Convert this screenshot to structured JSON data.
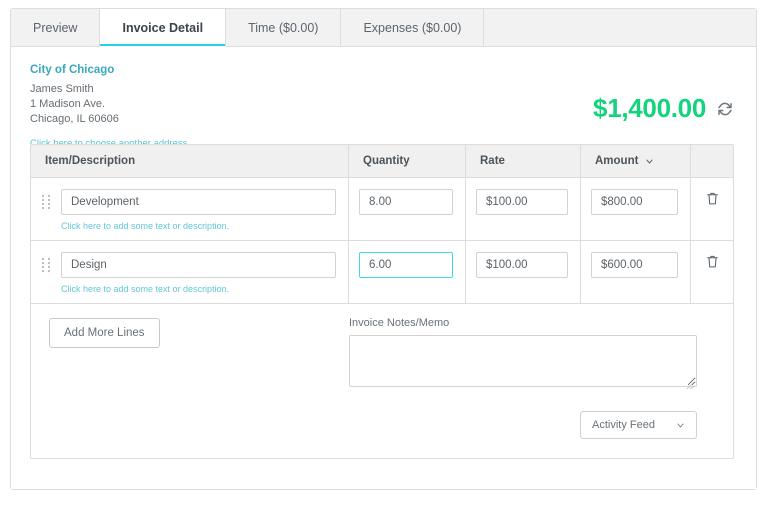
{
  "tabs": [
    {
      "label": "Preview",
      "active": false
    },
    {
      "label": "Invoice Detail",
      "active": true
    },
    {
      "label": "Time ($0.00)",
      "active": false
    },
    {
      "label": "Expenses ($0.00)",
      "active": false
    }
  ],
  "address": {
    "company": "City of Chicago",
    "name": "James Smith",
    "street": "1 Madison Ave.",
    "city_state_zip": "Chicago, IL 60606",
    "change_link": "Click here to choose another address."
  },
  "total": {
    "amount": "$1,400.00",
    "refresh_icon": "refresh-icon"
  },
  "table": {
    "headers": {
      "description": "Item/Description",
      "quantity": "Quantity",
      "rate": "Rate",
      "amount": "Amount",
      "actions": ""
    },
    "amount_sort_icon": "chevron-down-icon",
    "rows": [
      {
        "description": "Development",
        "description_link": "Click here to add some text or description.",
        "quantity": "8.00",
        "rate": "$100.00",
        "amount": "$800.00",
        "quantity_focused": false
      },
      {
        "description": "Design",
        "description_link": "Click here to add some text or description.",
        "quantity": "6.00",
        "rate": "$100.00",
        "amount": "$600.00",
        "quantity_focused": true
      }
    ]
  },
  "footer": {
    "add_lines_label": "Add More Lines",
    "notes_label": "Invoice Notes/Memo",
    "notes_value": "",
    "activity_feed_label": "Activity Feed"
  },
  "colors": {
    "accent_cyan": "#24d2e0",
    "total_green": "#13d47d",
    "link_teal": "#62c7d8",
    "heading_teal": "#3aa8bd"
  }
}
